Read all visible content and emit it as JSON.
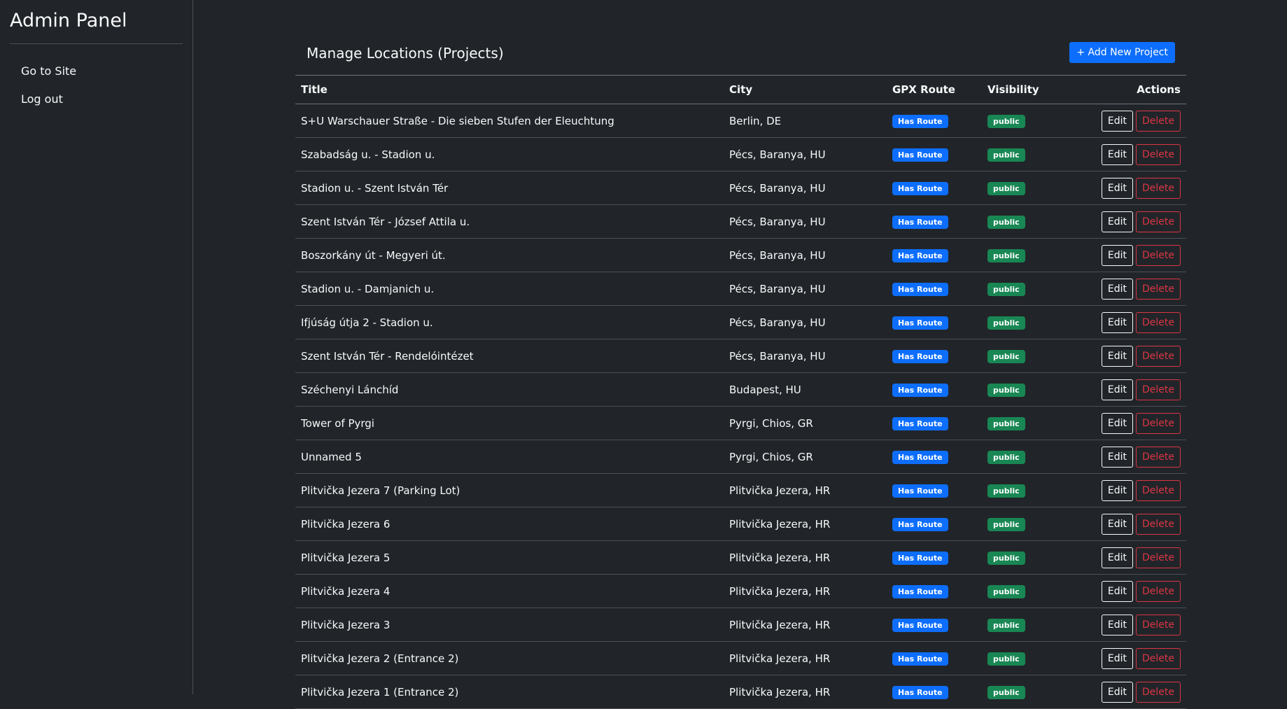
{
  "sidebar": {
    "brand": "Admin Panel",
    "links": [
      "Go to Site",
      "Log out"
    ]
  },
  "header": {
    "title": "Manage Locations (Projects)",
    "add_button": "+ Add New Project"
  },
  "table": {
    "columns": [
      "Title",
      "City",
      "GPX Route",
      "Visibility",
      "Actions"
    ],
    "edit_label": "Edit",
    "delete_label": "Delete",
    "rows": [
      {
        "title": "S+U Warschauer Straße - Die sieben Stufen der Eleuchtung",
        "city": "Berlin, DE",
        "route": "Has Route",
        "visibility": "public"
      },
      {
        "title": "Szabadság u. - Stadion u.",
        "city": "Pécs, Baranya, HU",
        "route": "Has Route",
        "visibility": "public"
      },
      {
        "title": "Stadion u. - Szent István Tér",
        "city": "Pécs, Baranya, HU",
        "route": "Has Route",
        "visibility": "public"
      },
      {
        "title": "Szent István Tér - József Attila u.",
        "city": "Pécs, Baranya, HU",
        "route": "Has Route",
        "visibility": "public"
      },
      {
        "title": "Boszorkány út - Megyeri út.",
        "city": "Pécs, Baranya, HU",
        "route": "Has Route",
        "visibility": "public"
      },
      {
        "title": "Stadion u. - Damjanich u.",
        "city": "Pécs, Baranya, HU",
        "route": "Has Route",
        "visibility": "public"
      },
      {
        "title": "Ifjúság útja 2 - Stadion u.",
        "city": "Pécs, Baranya, HU",
        "route": "Has Route",
        "visibility": "public"
      },
      {
        "title": "Szent István Tér - Rendelóintézet",
        "city": "Pécs, Baranya, HU",
        "route": "Has Route",
        "visibility": "public"
      },
      {
        "title": "Széchenyi Lánchíd",
        "city": "Budapest, HU",
        "route": "Has Route",
        "visibility": "public"
      },
      {
        "title": "Tower of Pyrgi",
        "city": "Pyrgi, Chios, GR",
        "route": "Has Route",
        "visibility": "public"
      },
      {
        "title": "Unnamed 5",
        "city": "Pyrgi, Chios, GR",
        "route": "Has Route",
        "visibility": "public"
      },
      {
        "title": "Plitvička Jezera 7 (Parking Lot)",
        "city": "Plitvička Jezera, HR",
        "route": "Has Route",
        "visibility": "public"
      },
      {
        "title": "Plitvička Jezera 6",
        "city": "Plitvička Jezera, HR",
        "route": "Has Route",
        "visibility": "public"
      },
      {
        "title": "Plitvička Jezera 5",
        "city": "Plitvička Jezera, HR",
        "route": "Has Route",
        "visibility": "public"
      },
      {
        "title": "Plitvička Jezera 4",
        "city": "Plitvička Jezera, HR",
        "route": "Has Route",
        "visibility": "public"
      },
      {
        "title": "Plitvička Jezera 3",
        "city": "Plitvička Jezera, HR",
        "route": "Has Route",
        "visibility": "public"
      },
      {
        "title": "Plitvička Jezera 2 (Entrance 2)",
        "city": "Plitvička Jezera, HR",
        "route": "Has Route",
        "visibility": "public"
      },
      {
        "title": "Plitvička Jezera 1 (Entrance 2)",
        "city": "Plitvička Jezera, HR",
        "route": "Has Route",
        "visibility": "public"
      }
    ]
  }
}
